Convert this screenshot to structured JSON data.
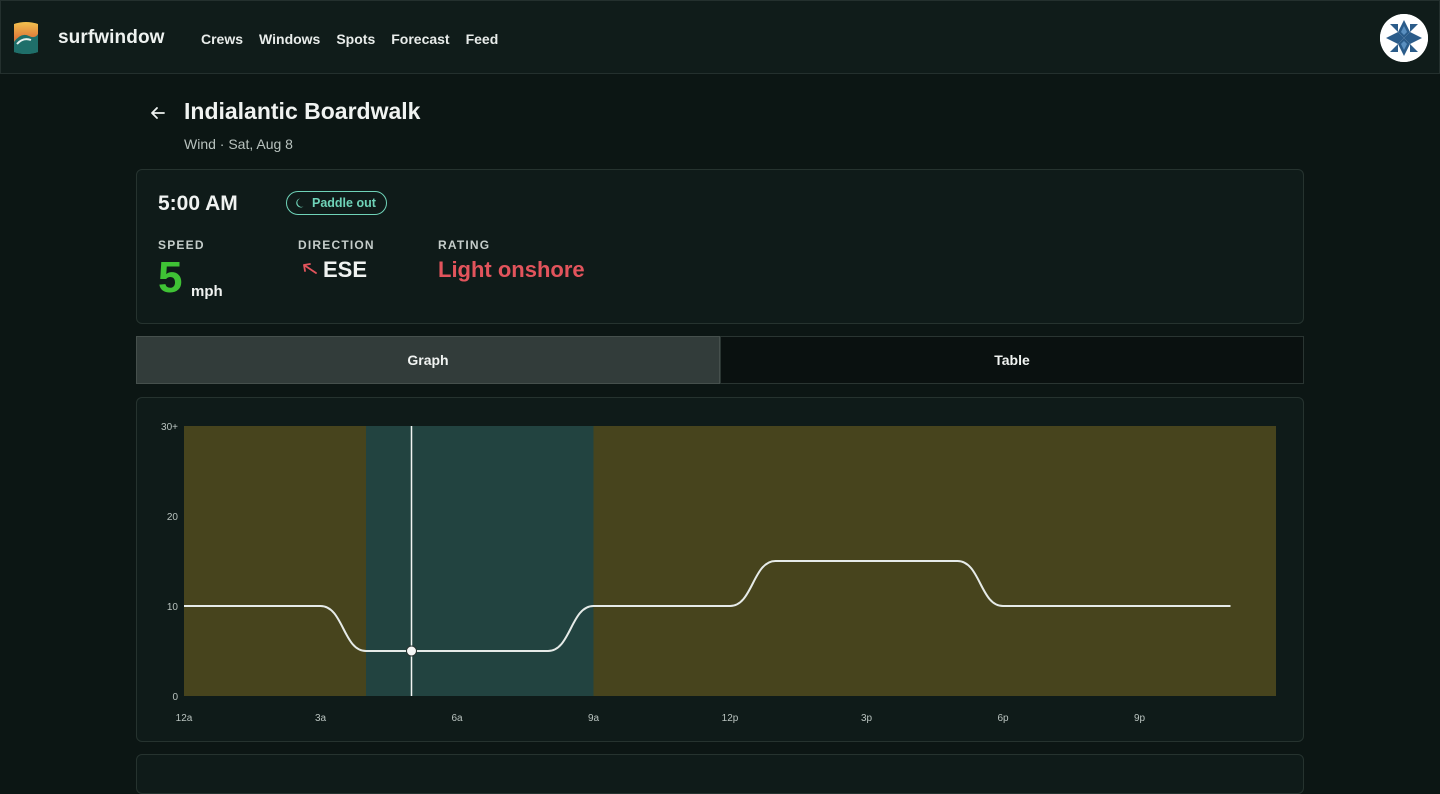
{
  "app": {
    "name": "surfwindow"
  },
  "nav": {
    "items": [
      "Crews",
      "Windows",
      "Spots",
      "Forecast",
      "Feed"
    ]
  },
  "page": {
    "title": "Indialantic Boardwalk",
    "subtitle": "Wind · Sat, Aug 8"
  },
  "current": {
    "time": "5:00 AM",
    "badge": "Paddle out",
    "speed_label": "SPEED",
    "speed_value": "5",
    "speed_unit": "mph",
    "direction_label": "DIRECTION",
    "direction_value": "ESE",
    "rating_label": "RATING",
    "rating_value": "Light onshore"
  },
  "tabs": [
    {
      "label": "Graph",
      "active": true
    },
    {
      "label": "Table",
      "active": false
    }
  ],
  "colors": {
    "speed": "#3fc235",
    "rating": "#e2545c",
    "onshore_band": "#47441d",
    "window_band": "#224340",
    "accent": "#6fd3b8"
  },
  "icons": {
    "logo": "wave-logo-icon",
    "back": "back-arrow-icon",
    "badge": "moon-icon",
    "direction": "direction-arrow-icon",
    "avatar": "quilt-avatar-icon"
  },
  "chart_data": {
    "type": "line",
    "y_ticks": [
      "0",
      "10",
      "20",
      "30+"
    ],
    "ylim": [
      0,
      30
    ],
    "x_ticks": [
      "12a",
      "3a",
      "6a",
      "9a",
      "12p",
      "3p",
      "6p",
      "9p"
    ],
    "x_tick_hours": [
      0,
      3,
      6,
      9,
      12,
      15,
      18,
      21
    ],
    "xlim": [
      0,
      24
    ],
    "series": [
      {
        "x": [
          0,
          3,
          4,
          5,
          6,
          7,
          8,
          9,
          12,
          13,
          14,
          15,
          16,
          17,
          18,
          21,
          23
        ],
        "y": [
          10,
          10,
          5,
          5,
          5,
          5,
          5,
          10,
          10,
          15,
          15,
          15,
          15,
          15,
          10,
          10,
          10
        ]
      }
    ],
    "bands": [
      {
        "from": 0,
        "to": 4,
        "kind": "onshore"
      },
      {
        "from": 4,
        "to": 9,
        "kind": "window"
      },
      {
        "from": 9,
        "to": 24,
        "kind": "onshore"
      }
    ],
    "cursor": {
      "x": 5,
      "y": 5
    }
  }
}
